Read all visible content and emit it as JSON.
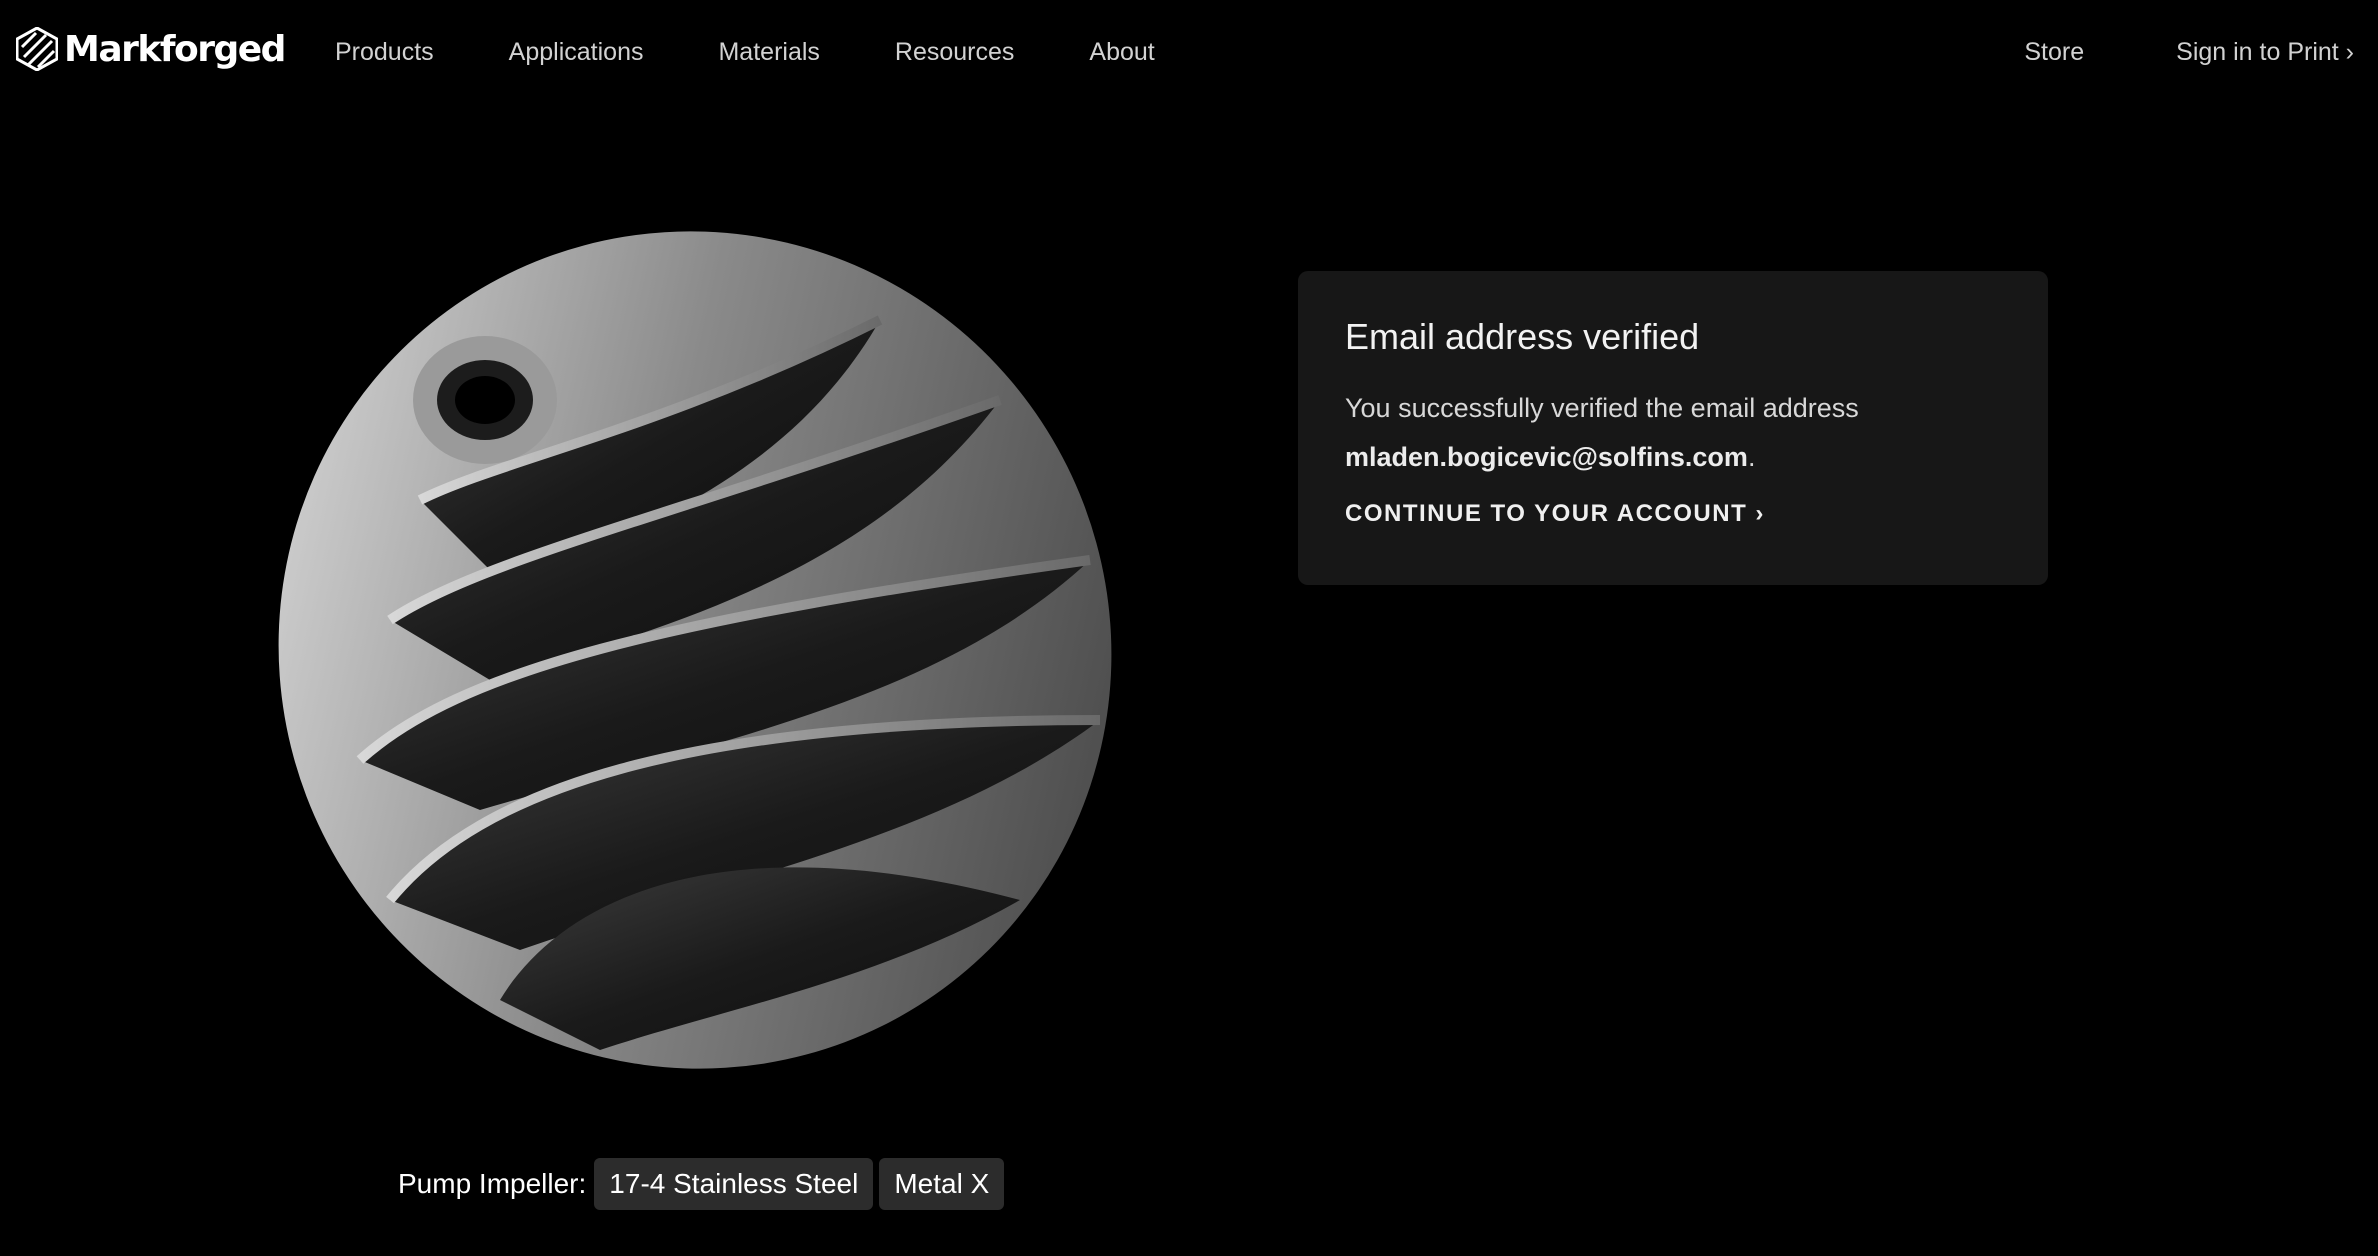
{
  "brand": {
    "name": "Markforged",
    "logo_icon": "markforged-stripes-icon"
  },
  "nav": {
    "items": [
      {
        "label": "Products"
      },
      {
        "label": "Applications"
      },
      {
        "label": "Materials"
      },
      {
        "label": "Resources"
      },
      {
        "label": "About"
      }
    ],
    "store": "Store",
    "sign_in": "Sign in to Print ›"
  },
  "card": {
    "title": "Email address verified",
    "body_prefix": "You successfully verified the email address ",
    "email": "mladen.bogicevic@solfins.com",
    "body_suffix": ".",
    "cta": "CONTINUE TO YOUR ACCOUNT ›"
  },
  "caption": {
    "label": "Pump Impeller:",
    "material": "17-4 Stainless Steel",
    "printer": "Metal X"
  },
  "colors": {
    "background": "#000000",
    "card": "#171717",
    "chip": "#2c2c2c",
    "nav_text": "#d2d2d2"
  }
}
